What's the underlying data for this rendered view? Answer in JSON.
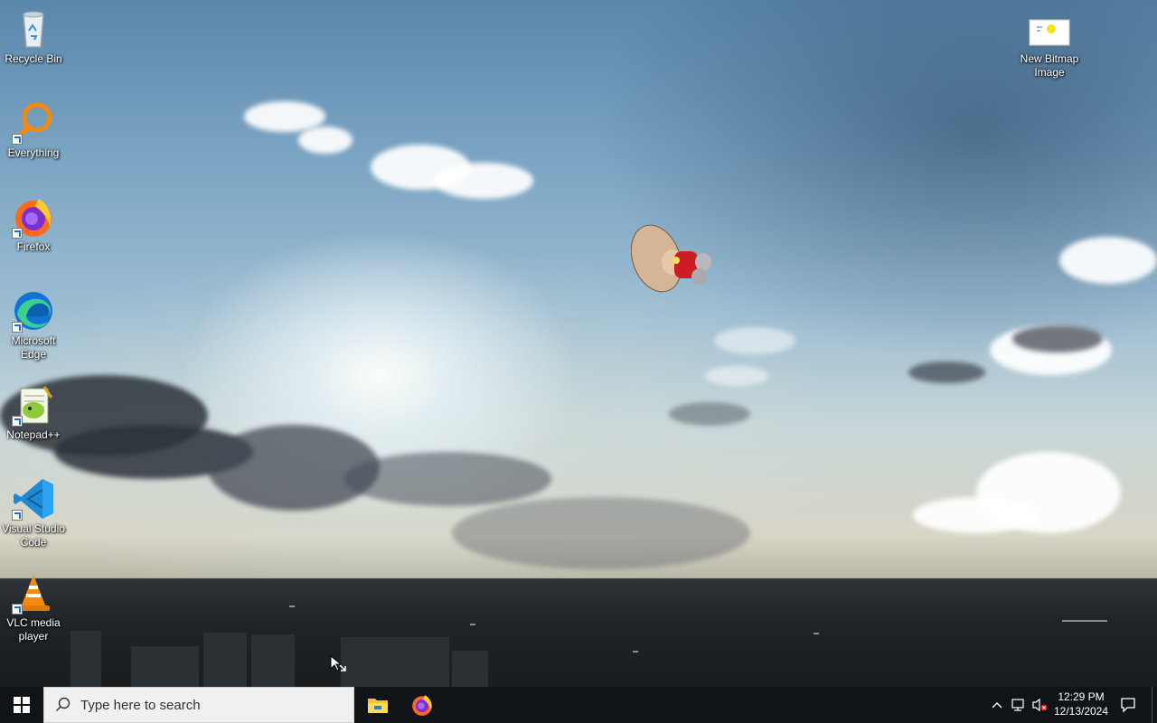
{
  "desktop_icons": [
    {
      "label": "Recycle Bin",
      "icon": "recycle-bin-icon"
    },
    {
      "label": "Everything",
      "icon": "everything-search-icon"
    },
    {
      "label": "Firefox",
      "icon": "firefox-icon"
    },
    {
      "label": "Microsoft Edge",
      "icon": "edge-icon"
    },
    {
      "label": "Notepad++",
      "icon": "notepad-plus-plus-icon"
    },
    {
      "label": "Visual Studio Code",
      "icon": "vscode-icon"
    },
    {
      "label": "VLC media player",
      "icon": "vlc-icon"
    },
    {
      "label": "New Bitmap Image",
      "icon": "bitmap-image-icon"
    }
  ],
  "taskbar": {
    "search_placeholder": "Type here to search",
    "pinned": [
      "file-explorer-icon",
      "firefox-icon"
    ],
    "tray_icons": [
      "chevron-up-icon",
      "network-icon",
      "volume-muted-icon"
    ],
    "time": "12:29 PM",
    "date": "12/13/2024",
    "notification_icon": "action-center-icon"
  },
  "colors": {
    "taskbar_bg": "#101417",
    "search_bg": "#f0f0f0"
  }
}
